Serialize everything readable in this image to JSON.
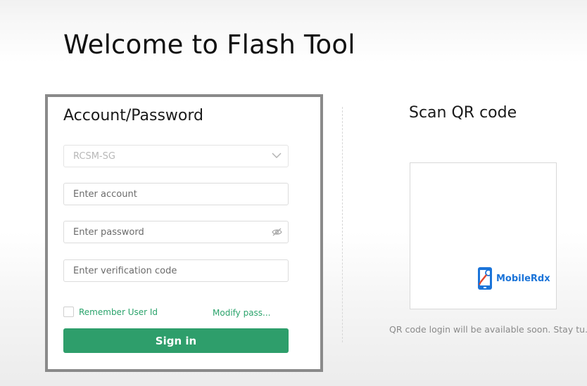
{
  "page": {
    "title": "Welcome to Flash Tool"
  },
  "login": {
    "heading": "Account/Password",
    "region_select": {
      "value": "RCSM-SG"
    },
    "account": {
      "placeholder": "Enter account",
      "value": ""
    },
    "password": {
      "placeholder": "Enter password",
      "value": ""
    },
    "verification": {
      "placeholder": "Enter verification code",
      "value": ""
    },
    "remember_label": "Remember User Id",
    "remember_checked": false,
    "modify_link": "Modify pass...",
    "signin_label": "Sign in"
  },
  "qr": {
    "heading": "Scan QR code",
    "watermark_text": "MobileRdx",
    "note": "QR code login will be available soon. Stay tu..."
  },
  "colors": {
    "accent": "#2e9e6b",
    "link": "#2aa36b",
    "panel_border": "#8a8a8a",
    "watermark": "#1b74d9"
  },
  "icons": {
    "select": "chevron-down-icon",
    "password": "eye-hidden-icon",
    "watermark": "phone-wrench-icon"
  }
}
